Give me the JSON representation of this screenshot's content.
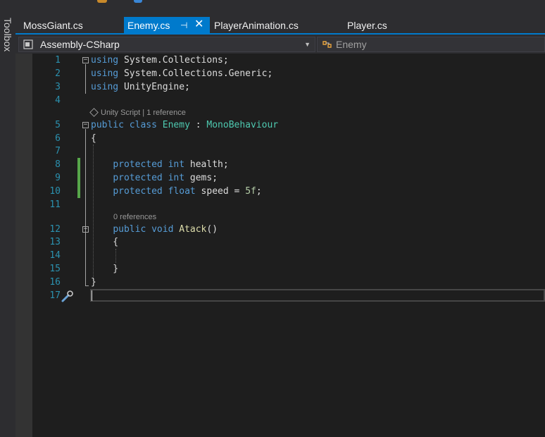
{
  "toolbox": {
    "label": "Toolbox"
  },
  "tabs": [
    {
      "label": "MossGiant.cs",
      "active": false
    },
    {
      "label": "Enemy.cs",
      "active": true,
      "pin_glyph": "⊣",
      "close_glyph": "✕"
    },
    {
      "label": "PlayerAnimation.cs",
      "active": false
    },
    {
      "label": "Player.cs",
      "active": false
    }
  ],
  "navbar": {
    "project": "Assembly-CSharp",
    "member": "Enemy"
  },
  "editor": {
    "lines": [
      {
        "n": "1",
        "tokens": [
          {
            "t": "using",
            "c": "kw"
          },
          {
            "t": " System.Collections;",
            "c": "pl"
          }
        ]
      },
      {
        "n": "2",
        "tokens": [
          {
            "t": "using",
            "c": "kw"
          },
          {
            "t": " System.Collections.Generic;",
            "c": "pl"
          }
        ]
      },
      {
        "n": "3",
        "tokens": [
          {
            "t": "using",
            "c": "kw"
          },
          {
            "t": " UnityEngine;",
            "c": "pl"
          }
        ]
      },
      {
        "n": "4",
        "tokens": []
      },
      {
        "n": "5",
        "tokens": [
          {
            "t": "public",
            "c": "kw"
          },
          {
            "t": " ",
            "c": "pl"
          },
          {
            "t": "class",
            "c": "kw"
          },
          {
            "t": " ",
            "c": "pl"
          },
          {
            "t": "Enemy",
            "c": "ty"
          },
          {
            "t": " : ",
            "c": "pl"
          },
          {
            "t": "MonoBehaviour",
            "c": "ty"
          }
        ]
      },
      {
        "n": "6",
        "tokens": [
          {
            "t": "{",
            "c": "pl"
          }
        ]
      },
      {
        "n": "7",
        "tokens": []
      },
      {
        "n": "8",
        "tokens": [
          {
            "t": "    ",
            "c": "pl"
          },
          {
            "t": "protected",
            "c": "kw"
          },
          {
            "t": " ",
            "c": "pl"
          },
          {
            "t": "int",
            "c": "kw"
          },
          {
            "t": " health;",
            "c": "pl"
          }
        ]
      },
      {
        "n": "9",
        "tokens": [
          {
            "t": "    ",
            "c": "pl"
          },
          {
            "t": "protected",
            "c": "kw"
          },
          {
            "t": " ",
            "c": "pl"
          },
          {
            "t": "int",
            "c": "kw"
          },
          {
            "t": " gems;",
            "c": "pl"
          }
        ]
      },
      {
        "n": "10",
        "tokens": [
          {
            "t": "    ",
            "c": "pl"
          },
          {
            "t": "protected",
            "c": "kw"
          },
          {
            "t": " ",
            "c": "pl"
          },
          {
            "t": "float",
            "c": "kw"
          },
          {
            "t": " speed = ",
            "c": "pl"
          },
          {
            "t": "5f",
            "c": "nm"
          },
          {
            "t": ";",
            "c": "pl"
          }
        ]
      },
      {
        "n": "11",
        "tokens": []
      },
      {
        "n": "12",
        "tokens": [
          {
            "t": "    ",
            "c": "pl"
          },
          {
            "t": "public",
            "c": "kw"
          },
          {
            "t": " ",
            "c": "pl"
          },
          {
            "t": "void",
            "c": "kw"
          },
          {
            "t": " ",
            "c": "pl"
          },
          {
            "t": "Atack",
            "c": "fn"
          },
          {
            "t": "()",
            "c": "pl"
          }
        ]
      },
      {
        "n": "13",
        "tokens": [
          {
            "t": "    {",
            "c": "pl"
          }
        ]
      },
      {
        "n": "14",
        "tokens": []
      },
      {
        "n": "15",
        "tokens": [
          {
            "t": "    }",
            "c": "pl"
          }
        ]
      },
      {
        "n": "16",
        "tokens": [
          {
            "t": "}",
            "c": "pl"
          }
        ]
      },
      {
        "n": "17",
        "tokens": []
      }
    ],
    "hints": {
      "class_hint": "Unity Script | 1 reference",
      "method_hint": "0 references"
    },
    "colors": {
      "keyword": "#569cd6",
      "type": "#4ec9b0",
      "method": "#dcdcaa",
      "number": "#b5cea8",
      "line_number": "#2b91af",
      "change_bar": "#57a64a",
      "accent": "#007acc"
    }
  }
}
